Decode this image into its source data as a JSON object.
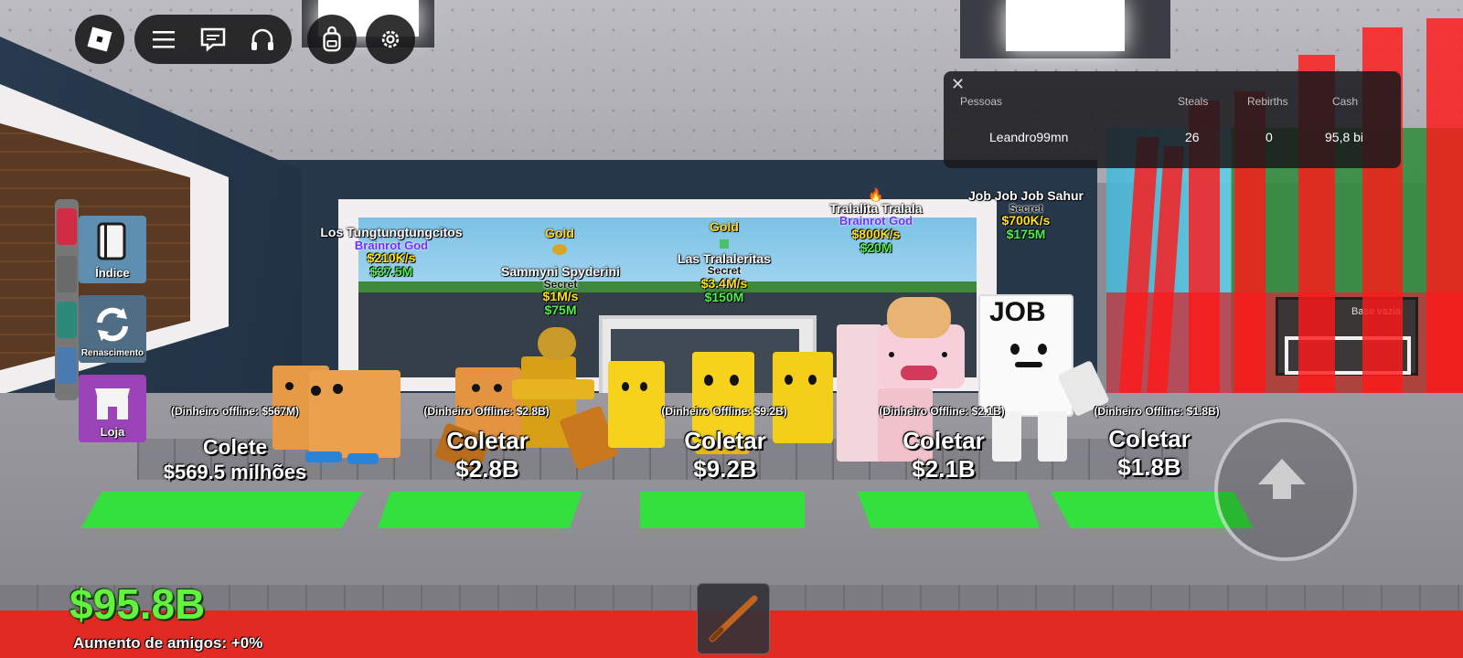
{
  "top_menu": {
    "roblox_icon": "roblox-logo-icon",
    "menu_icon": "hamburger-menu-icon",
    "chat_icon": "chat-bubble-icon",
    "voice_icon": "headphones-icon",
    "backpack_icon": "backpack-icon",
    "settings_icon": "gear-icon"
  },
  "leaderboard": {
    "close": "✕",
    "columns": [
      "Pessoas",
      "Steals",
      "Rebirths",
      "Cash"
    ],
    "rows": [
      {
        "player": "Leandro99mn",
        "steals": "26",
        "rebirths": "0",
        "cash": "95,8 bi"
      }
    ]
  },
  "side_menu": {
    "index_label": "Índice",
    "rebirth_label": "Renascimento",
    "shop_label": "Loja",
    "index_color": "#5f8fb0",
    "rebirth_color": "#4f6e86",
    "shop_color": "#9a44b8"
  },
  "brainrots": [
    {
      "name": "Los Tungtungtungcitos",
      "rarity": "Brainrot God",
      "rate": "$210K/s",
      "value": "$37.5M"
    },
    {
      "mutation": "Gold"
    },
    {
      "name": "Sammyni Spyderini",
      "rarity": "Secret",
      "rate": "$1M/s",
      "value": "$75M"
    },
    {
      "mutation": "Gold",
      "name": "Las Tralaleritas",
      "rarity": "Secret",
      "rate": "$3.4M/s",
      "value": "$150M"
    },
    {
      "name": "Tralalita Tralala",
      "rarity": "Brainrot God",
      "rate": "$800K/s",
      "value": "$20M"
    },
    {
      "name": "Job Job Job Sahur",
      "rarity": "Secret",
      "rate": "$700K/s",
      "value": "$175M"
    }
  ],
  "sign_text": "JOB",
  "collect_pads": [
    {
      "offline": "(Dinheiro offline: $567M)",
      "action": "Colete",
      "amount": "$569.5 milhões"
    },
    {
      "offline": "(Dinheiro Offline: $2.8B)",
      "action": "Coletar",
      "amount": "$2.8B"
    },
    {
      "offline": "(Dinheiro Offline: $9.2B)",
      "action": "Coletar",
      "amount": "$9.2B"
    },
    {
      "offline": "(Dinheiro Offline: $2.1B)",
      "action": "Coletar",
      "amount": "$2.1B"
    },
    {
      "offline": "(Dinheiro Offline: $1.8B)",
      "action": "Coletar",
      "amount": "$1.8B"
    }
  ],
  "base_sign": "Base vazia",
  "hud": {
    "cash": "$95.8B",
    "friend_boost": "Aumento de amigos: +0%",
    "cash_color": "#63f23d"
  },
  "hotbar": {
    "slot1_icon": "bat-icon"
  },
  "jump_button_icon": "jump-arrow-icon",
  "colors": {
    "pad_green": "#33e03e",
    "lava_red": "#e12a21",
    "laser_red": "#ff1919"
  }
}
